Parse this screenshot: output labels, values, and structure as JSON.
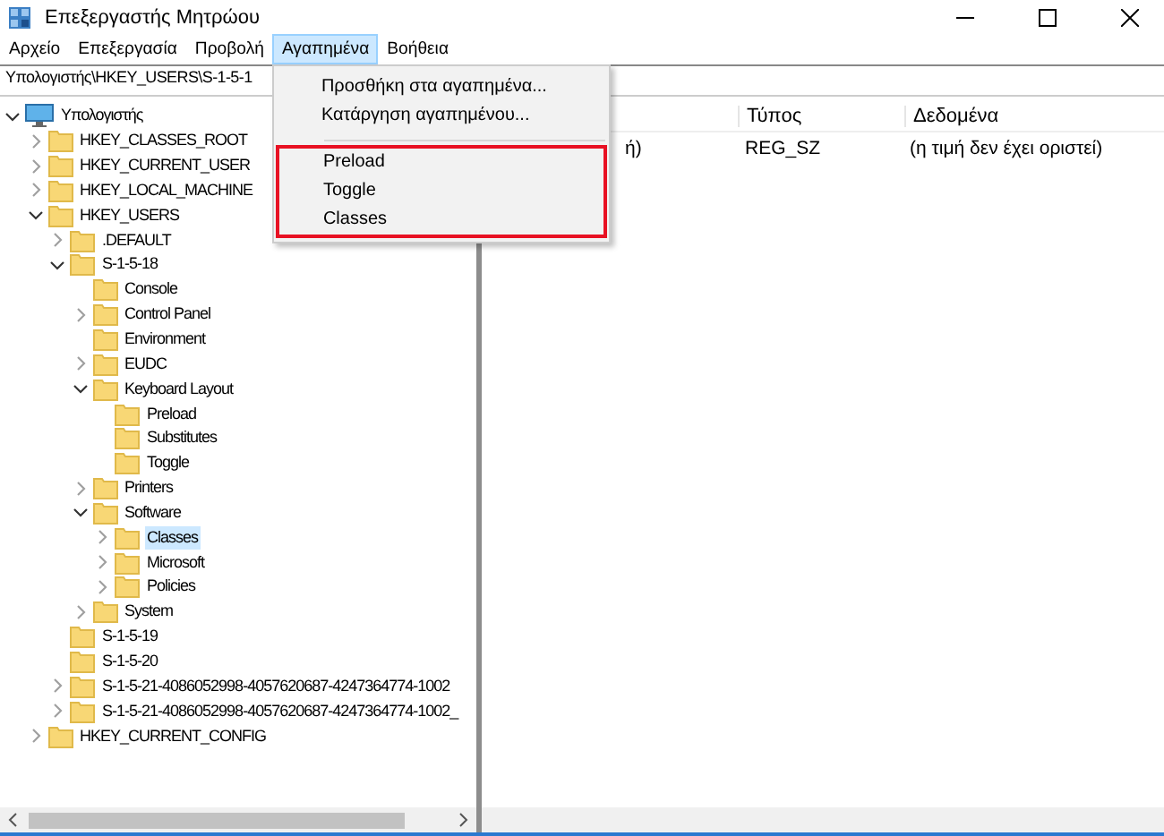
{
  "window": {
    "title": "Επεξεργαστής Μητρώου"
  },
  "menu_bar": [
    {
      "label": "Αρχείο",
      "selected": false
    },
    {
      "label": "Επεξεργασία",
      "selected": false
    },
    {
      "label": "Προβολή",
      "selected": false
    },
    {
      "label": "Αγαπημένα",
      "selected": true
    },
    {
      "label": "Βοήθεια",
      "selected": false
    }
  ],
  "favorites_menu": {
    "sections": [
      {
        "highlighted": false,
        "items": [
          "Προσθήκη στα αγαπημένα...",
          "Κατάργηση αγαπημένου..."
        ]
      },
      {
        "highlighted": true,
        "items": [
          "Preload",
          "Toggle",
          "Classes"
        ]
      }
    ]
  },
  "address_bar": {
    "value": "Υπολογιστής\\HKEY_USERS\\S-1-5-1"
  },
  "tree": [
    {
      "label": "Υπολογιστής",
      "kind": "computer",
      "expandable": true,
      "expanded": true,
      "selected": false,
      "children": [
        {
          "label": "HKEY_CLASSES_ROOT",
          "kind": "folder",
          "expandable": true,
          "expanded": false,
          "selected": false
        },
        {
          "label": "HKEY_CURRENT_USER",
          "kind": "folder",
          "expandable": true,
          "expanded": false,
          "selected": false
        },
        {
          "label": "HKEY_LOCAL_MACHINE",
          "kind": "folder",
          "expandable": true,
          "expanded": false,
          "selected": false
        },
        {
          "label": "HKEY_USERS",
          "kind": "folder",
          "expandable": true,
          "expanded": true,
          "selected": false,
          "children": [
            {
              "label": ".DEFAULT",
              "kind": "folder",
              "expandable": true,
              "expanded": false,
              "selected": false
            },
            {
              "label": "S-1-5-18",
              "kind": "folder",
              "expandable": true,
              "expanded": true,
              "selected": false,
              "children": [
                {
                  "label": "Console",
                  "kind": "folder",
                  "expandable": false,
                  "selected": false
                },
                {
                  "label": "Control Panel",
                  "kind": "folder",
                  "expandable": true,
                  "expanded": false,
                  "selected": false
                },
                {
                  "label": "Environment",
                  "kind": "folder",
                  "expandable": false,
                  "selected": false
                },
                {
                  "label": "EUDC",
                  "kind": "folder",
                  "expandable": true,
                  "expanded": false,
                  "selected": false
                },
                {
                  "label": "Keyboard Layout",
                  "kind": "folder",
                  "expandable": true,
                  "expanded": true,
                  "selected": false,
                  "children": [
                    {
                      "label": "Preload",
                      "kind": "folder",
                      "expandable": false,
                      "selected": false
                    },
                    {
                      "label": "Substitutes",
                      "kind": "folder",
                      "expandable": false,
                      "selected": false
                    },
                    {
                      "label": "Toggle",
                      "kind": "folder",
                      "expandable": false,
                      "selected": false
                    }
                  ]
                },
                {
                  "label": "Printers",
                  "kind": "folder",
                  "expandable": true,
                  "expanded": false,
                  "selected": false
                },
                {
                  "label": "Software",
                  "kind": "folder",
                  "expandable": true,
                  "expanded": true,
                  "selected": false,
                  "children": [
                    {
                      "label": "Classes",
                      "kind": "folder",
                      "expandable": true,
                      "expanded": false,
                      "selected": true
                    },
                    {
                      "label": "Microsoft",
                      "kind": "folder",
                      "expandable": true,
                      "expanded": false,
                      "selected": false
                    },
                    {
                      "label": "Policies",
                      "kind": "folder",
                      "expandable": true,
                      "expanded": false,
                      "selected": false
                    }
                  ]
                },
                {
                  "label": "System",
                  "kind": "folder",
                  "expandable": true,
                  "expanded": false,
                  "selected": false
                }
              ]
            },
            {
              "label": "S-1-5-19",
              "kind": "folder",
              "expandable": false,
              "selected": false
            },
            {
              "label": "S-1-5-20",
              "kind": "folder",
              "expandable": false,
              "selected": false
            },
            {
              "label": "S-1-5-21-4086052998-4057620687-4247364774-1002",
              "kind": "folder",
              "expandable": true,
              "expanded": false,
              "selected": false
            },
            {
              "label": "S-1-5-21-4086052998-4057620687-4247364774-1002_",
              "kind": "folder",
              "expandable": true,
              "expanded": false,
              "selected": false
            }
          ]
        },
        {
          "label": "HKEY_CURRENT_CONFIG",
          "kind": "folder",
          "expandable": true,
          "expanded": false,
          "selected": false
        }
      ]
    }
  ],
  "values_table": {
    "columns": [
      "Τύπος",
      "Δεδομένα"
    ],
    "rows": [
      {
        "name": "ή)",
        "type": "REG_SZ",
        "data": "(η τιμή δεν έχει οριστεί)"
      }
    ]
  }
}
